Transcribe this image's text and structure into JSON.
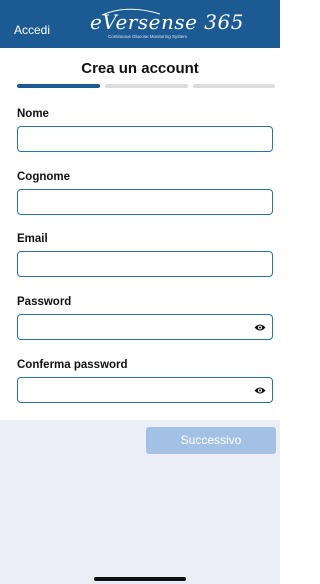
{
  "header": {
    "back_label": "Accedi",
    "logo_text": "eVersense 365",
    "logo_tagline": "Continuous Glucose Monitoring System",
    "background_color": "#1b5a93"
  },
  "page": {
    "title": "Crea un account"
  },
  "progress": {
    "total_steps": 3,
    "current_step": 1,
    "active_color": "#1b5a93",
    "inactive_color": "#dcdcdc"
  },
  "form": {
    "fields": [
      {
        "label": "Nome",
        "value": "",
        "type": "text"
      },
      {
        "label": "Cognome",
        "value": "",
        "type": "text"
      },
      {
        "label": "Email",
        "value": "",
        "type": "email"
      },
      {
        "label": "Password",
        "value": "",
        "type": "password",
        "icon": "eye-icon"
      },
      {
        "label": "Conferma password",
        "value": "",
        "type": "password",
        "icon": "eye-icon"
      }
    ]
  },
  "footer": {
    "next_label": "Successivo",
    "next_enabled": false,
    "next_color": "#a3c1e5"
  }
}
